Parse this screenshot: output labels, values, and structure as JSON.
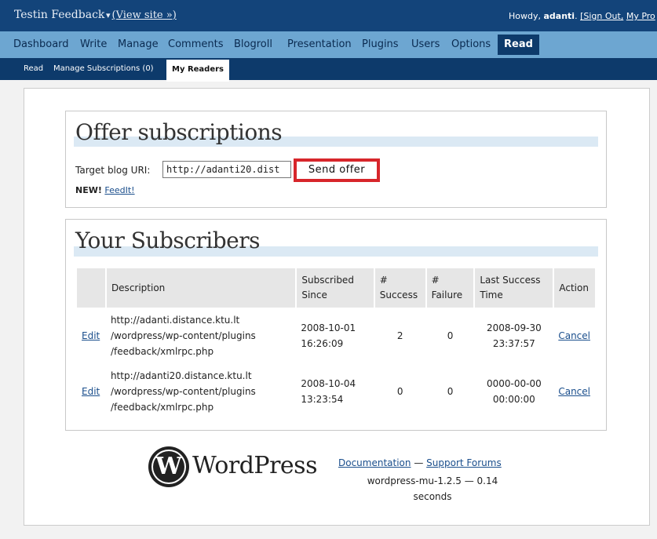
{
  "header": {
    "site_title": "Testin Feedback",
    "view_site": "(View site »)",
    "howdy_prefix": "Howdy,",
    "username": "adanti",
    "sign_out": "[Sign Out,",
    "my_profile": "My Pro"
  },
  "main_nav": [
    "Dashboard",
    "Write",
    "Manage",
    "Comments",
    "Blogroll",
    "Presentation",
    "Plugins",
    "Users",
    "Options",
    "Read"
  ],
  "sub_nav": [
    "Read",
    "Manage Subscriptions (0)",
    "My Readers"
  ],
  "offer": {
    "title": "Offer subscriptions",
    "uri_label": "Target blog URI:",
    "uri_value": "http://adanti20.dist",
    "send_button": "Send offer",
    "new_label": "NEW!",
    "feedit_link": "FeedIt!"
  },
  "subscribers": {
    "title": "Your Subscribers",
    "headers": {
      "description": "Description",
      "subscribed_since": "Subscribed Since",
      "success": "# Success",
      "failure": "# Failure",
      "last_success": "Last Success Time",
      "action": "Action"
    },
    "rows": [
      {
        "edit": "Edit",
        "desc_1": "http://adanti.distance.ktu.lt",
        "desc_2": "/wordpress/wp-content/plugins",
        "desc_3": "/feedback/xmlrpc.php",
        "since_date": "2008-10-01",
        "since_time": "16:26:09",
        "success": "2",
        "failure": "0",
        "last_date": "2008-09-30",
        "last_time": "23:37:57",
        "action": "Cancel"
      },
      {
        "edit": "Edit",
        "desc_1": "http://adanti20.distance.ktu.lt",
        "desc_2": "/wordpress/wp-content/plugins",
        "desc_3": "/feedback/xmlrpc.php",
        "since_date": "2008-10-04",
        "since_time": "13:23:54",
        "success": "0",
        "failure": "0",
        "last_date": "0000-00-00",
        "last_time": "00:00:00",
        "action": "Cancel"
      }
    ]
  },
  "footer": {
    "logo_text": "WordPress",
    "documentation": "Documentation",
    "separator": "—",
    "support": "Support Forums",
    "version_line1": "wordpress-mu-1.2.5 — 0.14",
    "version_line2": "seconds"
  },
  "colors": {
    "header_bg": "#13447a",
    "nav_bg": "#6da6d1",
    "subnav_bg": "#0d3a6b",
    "highlight_red": "#d7262b",
    "link": "#1a4e8c"
  }
}
